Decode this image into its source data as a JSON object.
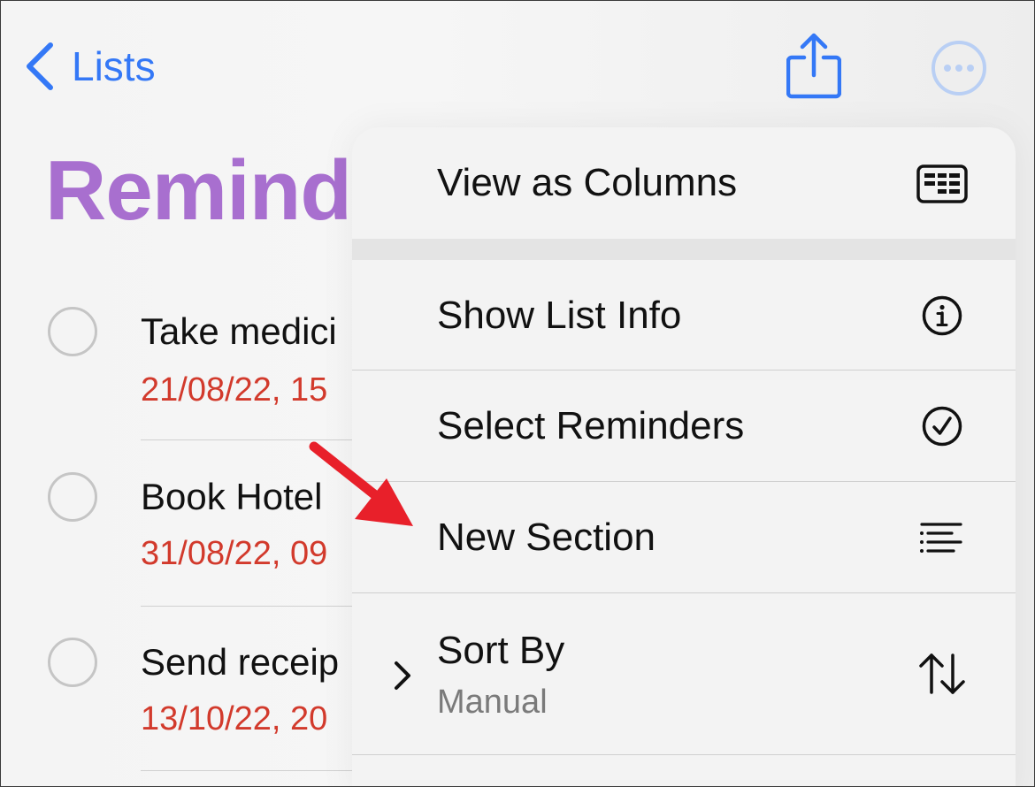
{
  "nav": {
    "back_label": "Lists",
    "back_icon": "chevron-left-icon",
    "share_icon": "share-icon",
    "more_icon": "ellipsis-circle-icon",
    "accent_color": "#3478f6"
  },
  "list": {
    "title": "Remind",
    "title_color": "#a86fcf",
    "reminders": [
      {
        "title": "Take medici",
        "date": "21/08/22, 15"
      },
      {
        "title": "Book Hotel",
        "date": "31/08/22, 09"
      },
      {
        "title": "Send receip",
        "date": "13/10/22, 20"
      }
    ],
    "date_color": "#d23a2c"
  },
  "menu": {
    "items": [
      {
        "label": "View as Columns",
        "icon": "columns-icon"
      },
      {
        "label": "Show List Info",
        "icon": "info-icon"
      },
      {
        "label": "Select Reminders",
        "icon": "checkmark-circle-icon"
      },
      {
        "label": "New Section",
        "icon": "text-align-left-icon"
      },
      {
        "label": "Sort By",
        "sublabel": "Manual",
        "icon": "sort-arrows-icon",
        "submenu_icon": "chevron-right-icon"
      }
    ]
  },
  "annotation": {
    "arrow_color": "#e8202a",
    "icon": "red-arrow-icon"
  }
}
